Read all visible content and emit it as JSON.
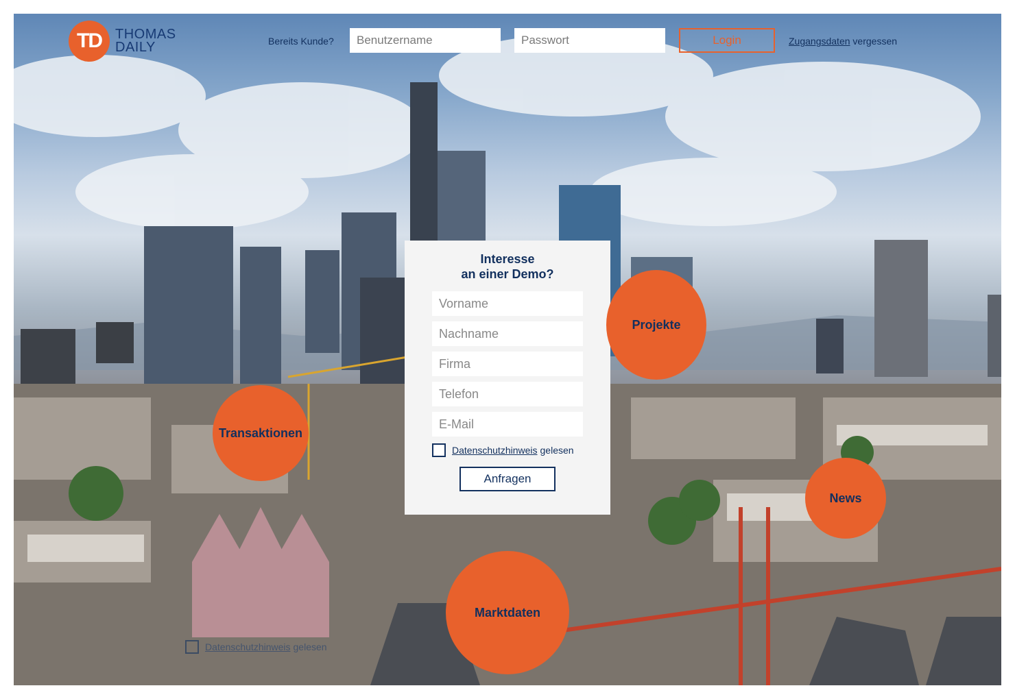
{
  "brand": {
    "mark": "TD",
    "line1": "THOMAS",
    "line2": "DAILY",
    "accent": "#e8612c",
    "navy": "#12305e"
  },
  "login": {
    "already_customer": "Bereits Kunde?",
    "username_placeholder": "Benutzername",
    "password_placeholder": "Passwort",
    "login_label": "Login",
    "forgot_link": "Zugangsdaten",
    "forgot_rest": "vergessen"
  },
  "demo": {
    "title_line1": "Interesse",
    "title_line2": "an einer Demo?",
    "fields": [
      "Vorname",
      "Nachname",
      "Firma",
      "Telefon",
      "E-Mail"
    ],
    "privacy_link": "Datenschutzhinweis",
    "privacy_rest": "gelesen",
    "submit_label": "Anfragen"
  },
  "circles": {
    "projekte": "Projekte",
    "transaktionen": "Transaktionen",
    "news": "News",
    "marktdaten": "Marktdaten"
  },
  "ghost_privacy": {
    "link": "Datenschutzhinweis",
    "rest": "gelesen"
  },
  "icons": {
    "background": "city-skyline-photo"
  }
}
